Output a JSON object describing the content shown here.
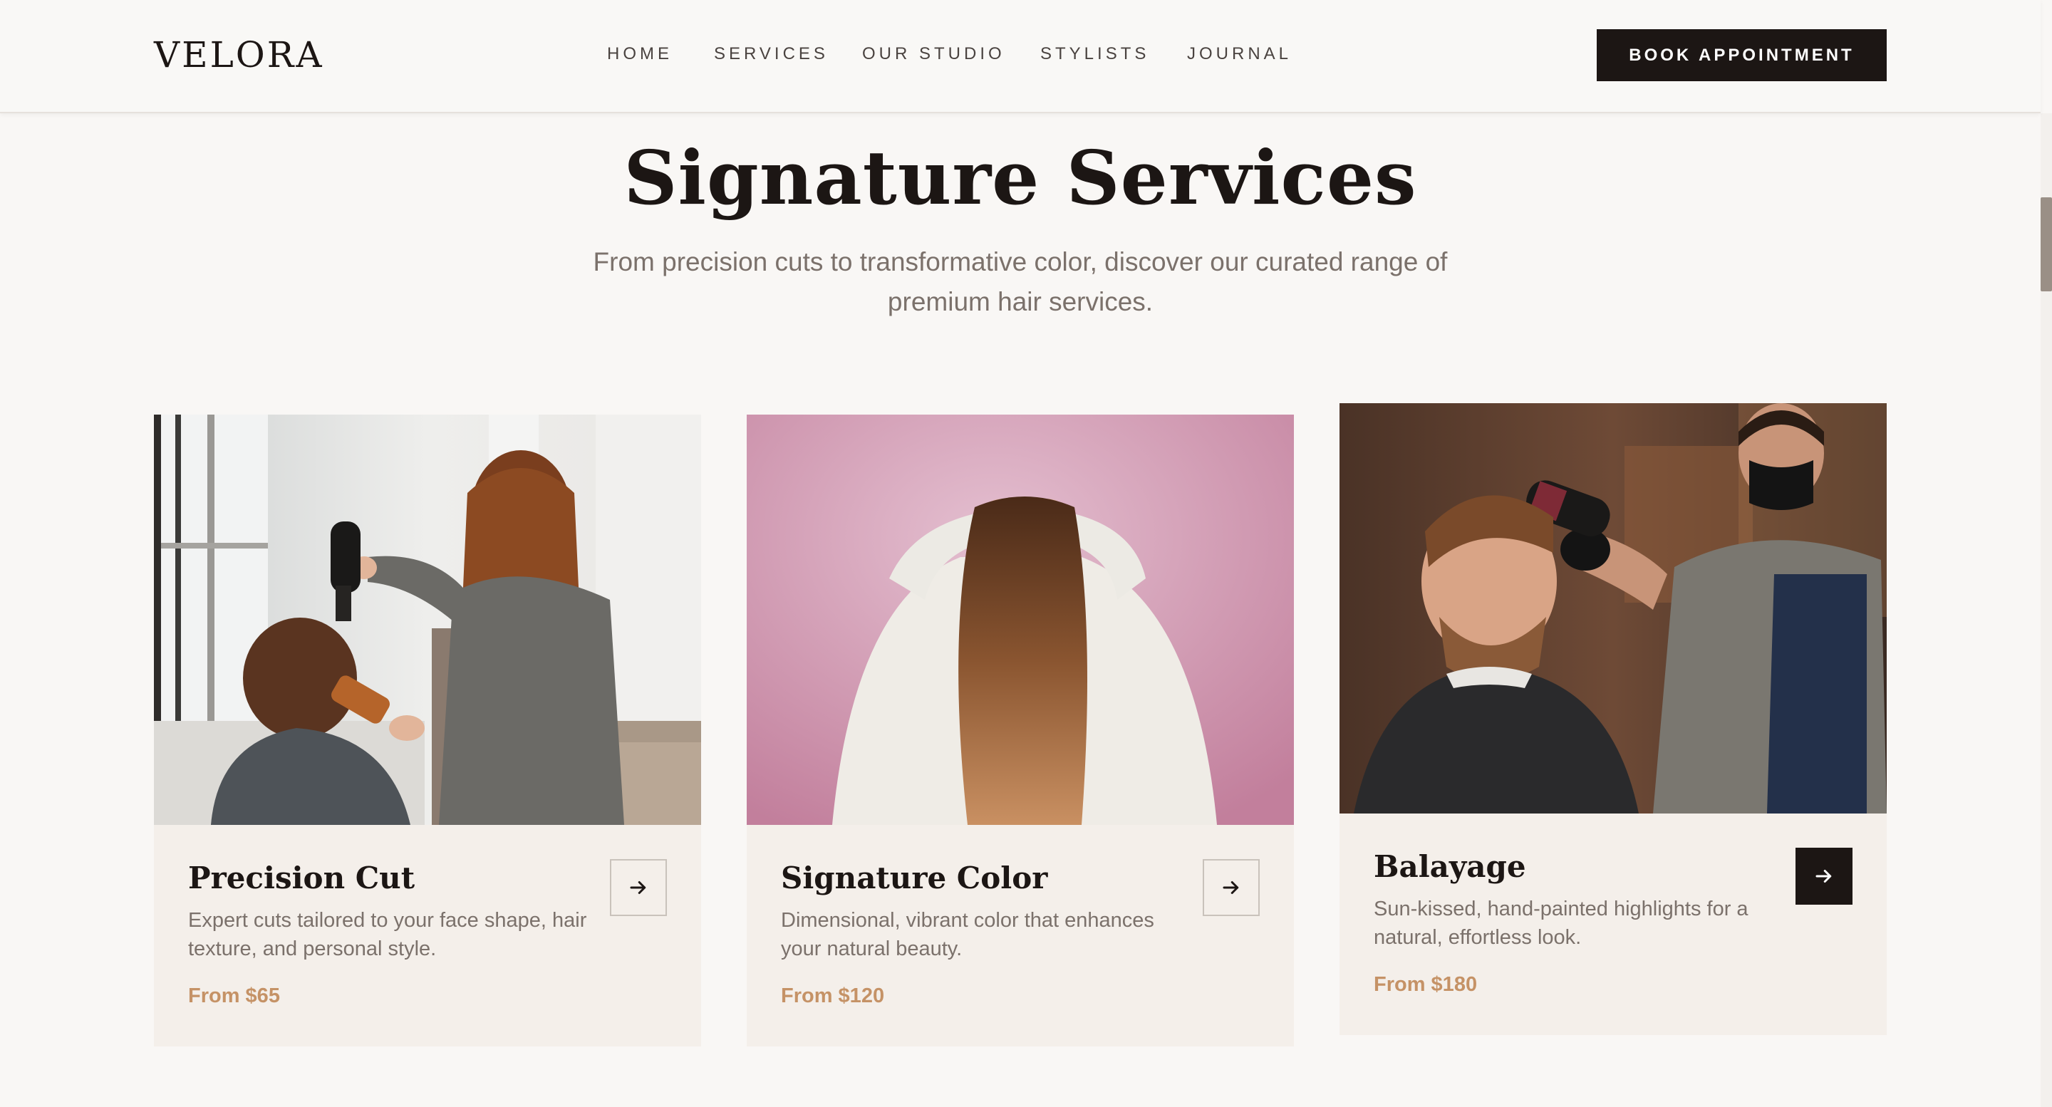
{
  "header": {
    "logo": "VELORA",
    "nav": [
      "HOME",
      "SERVICES",
      "OUR STUDIO",
      "STYLISTS",
      "JOURNAL"
    ],
    "cta": "BOOK APPOINTMENT"
  },
  "section": {
    "title": "Signature Services",
    "subtitle": "From precision cuts to transformative color, discover our curated range of premium hair services."
  },
  "cards": [
    {
      "title": "Precision Cut",
      "description": "Expert cuts tailored to your face shape, hair texture, and personal style.",
      "price": "From $65",
      "image_icon": "salon-blowdry-photo",
      "arrow_icon": "arrow-right-icon"
    },
    {
      "title": "Signature Color",
      "description": "Dimensional, vibrant color that enhances your natural beauty.",
      "price": "From $120",
      "image_icon": "long-hair-back-photo",
      "arrow_icon": "arrow-right-icon"
    },
    {
      "title": "Balayage",
      "description": "Sun-kissed, hand-painted highlights for a natural, effortless look.",
      "price": "From $180",
      "image_icon": "barber-styling-photo",
      "arrow_icon": "arrow-right-icon",
      "hovered": true
    }
  ],
  "colors": {
    "background": "#f9f7f5",
    "card": "#f4efea",
    "dark": "#1c1614",
    "muted_text": "#7b716b",
    "price": "#c59266"
  }
}
